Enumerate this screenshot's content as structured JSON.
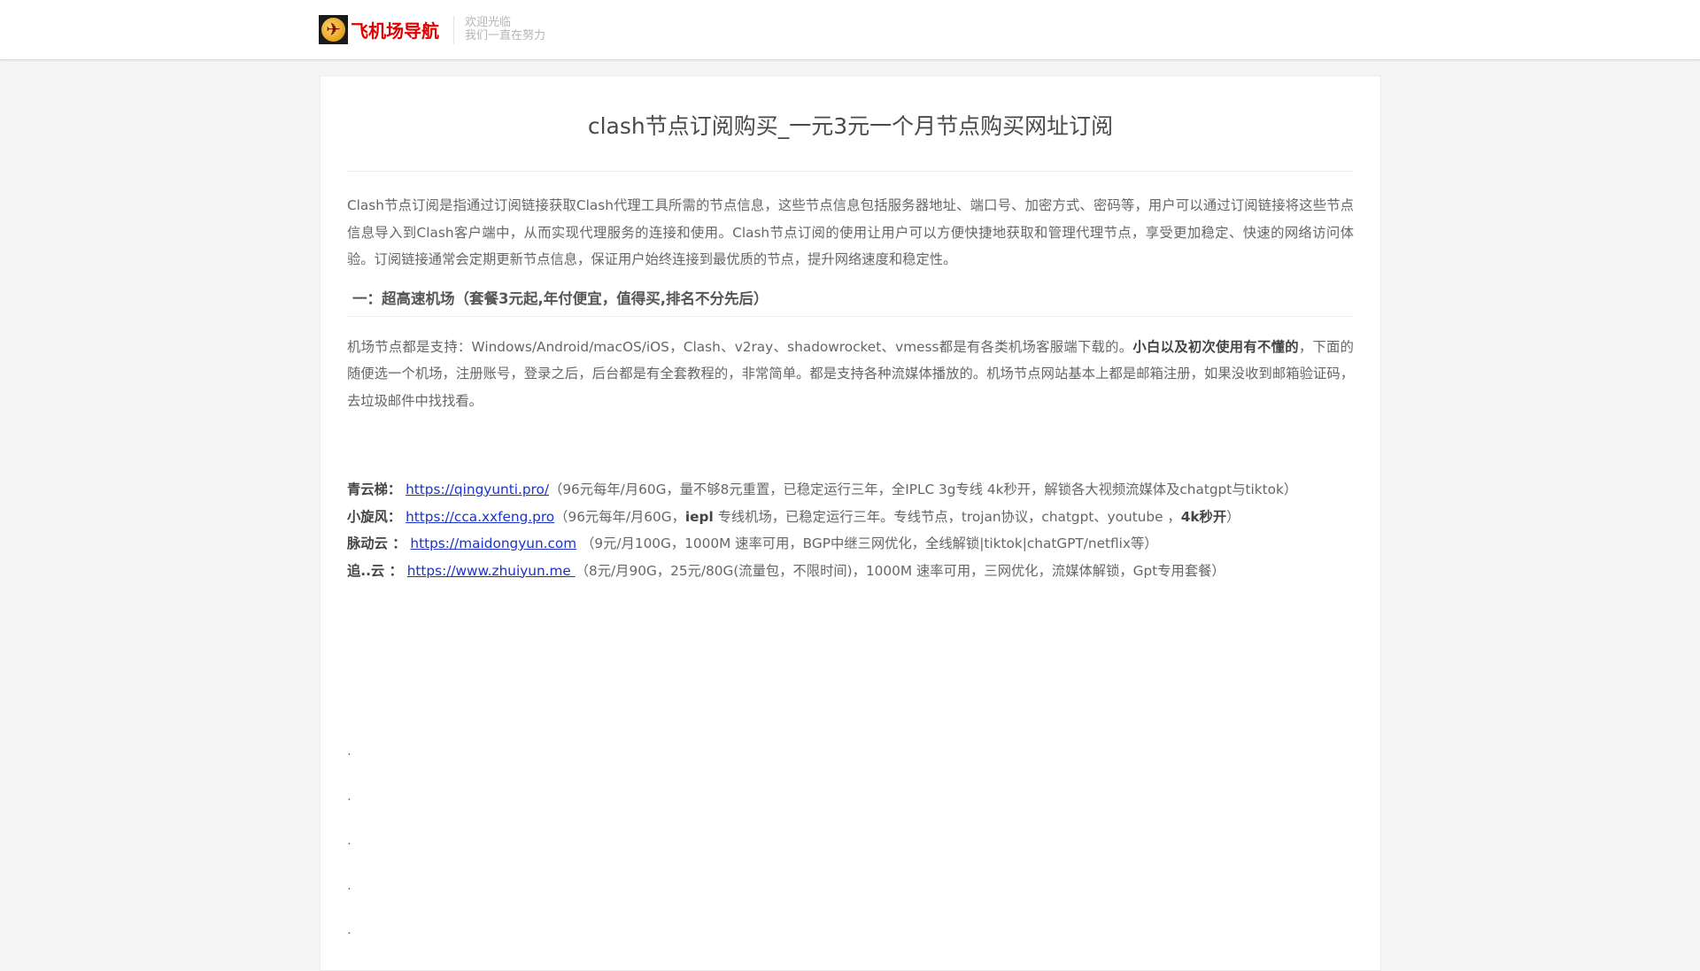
{
  "header": {
    "logo_text": "飞机场导航",
    "welcome_line1": "欢迎光临",
    "welcome_line2": "我们一直在努力"
  },
  "article": {
    "title": "clash节点订阅购买_一元3元一个月节点购买网址订阅",
    "intro": "Clash节点订阅是指通过订阅链接获取Clash代理工具所需的节点信息，这些节点信息包括服务器地址、端口号、加密方式、密码等，用户可以通过订阅链接将这些节点信息导入到Clash客户端中，从而实现代理服务的连接和使用。Clash节点订阅的使用让用户可以方便快捷地获取和管理代理节点，享受更加稳定、快速的网络访问体验。订阅链接通常会定期更新节点信息，保证用户始终连接到最优质的节点，提升网络速度和稳定性。",
    "section1_heading": "一：超高速机场（套餐3元起,年付便宜，值得买,排名不分先后）",
    "section1_text_a": "机场节点都是支持：Windows/Android/macOS/iOS，Clash、v2ray、shadowrocket、vmess都是有各类机场客服端下载的。",
    "section1_text_bold": "小白以及初次使用有不懂的",
    "section1_text_b": "，下面的随便选一个机场，注册账号，登录之后，后台都是有全套教程的，非常简单。都是支持各种流媒体播放的。机场节点网站基本上都是邮箱注册，如果没收到邮箱验证码，去垃圾邮件中找找看。",
    "links": [
      {
        "name": "青云梯：",
        "url": "https://qingyunti.pro/",
        "desc_a": "（96元每年/月60G，量不够8元重置，已稳定运行三年，全IPLC 3g专线 4k秒开，解锁各大视频流媒体及chatgpt与tiktok）",
        "desc_bold": "",
        "desc_b": "",
        "desc_bold2": "",
        "desc_c": ""
      },
      {
        "name": "小旋风：",
        "url": "https://cca.xxfeng.pro",
        "desc_a": "（96元每年/月60G，",
        "desc_bold": "iepl",
        "desc_b": " 专线机场，已稳定运行三年。专线节点，trojan协议，chatgpt、youtube ，",
        "desc_bold2": "4k秒开",
        "desc_c": "）"
      },
      {
        "name": "脉动云 ：",
        "url": "https://maidongyun.com",
        "desc_a": " （9元/月100G，1000M 速率可用，BGP中继三网优化，全线解锁|tiktok|chatGPT/netflix等）",
        "desc_bold": "",
        "desc_b": "",
        "desc_bold2": "",
        "desc_c": ""
      },
      {
        "name": "追..云 ：",
        "url": "https://www.zhuiyun.me ",
        "desc_a": "（8元/月90G，25元/80G(流量包，不限时间)，1000M 速率可用，三网优化，流媒体解锁，Gpt专用套餐）",
        "desc_bold": "",
        "desc_b": "",
        "desc_bold2": "",
        "desc_c": ""
      }
    ],
    "dots": [
      ".",
      ".",
      ".",
      ".",
      "."
    ]
  }
}
